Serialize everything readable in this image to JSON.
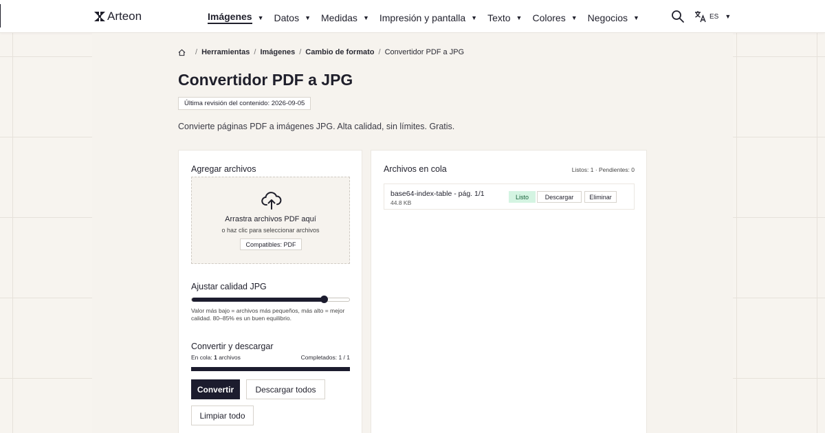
{
  "brand": {
    "name": "Arteon"
  },
  "nav": {
    "items": [
      {
        "label": "Imágenes",
        "active": true
      },
      {
        "label": "Datos"
      },
      {
        "label": "Medidas"
      },
      {
        "label": "Impresión y pantalla"
      },
      {
        "label": "Texto"
      },
      {
        "label": "Colores"
      },
      {
        "label": "Negocios"
      }
    ],
    "caret": "▼",
    "search_icon": "search-icon",
    "language": {
      "code": "ES",
      "icon": "translate-icon"
    }
  },
  "breadcrumb": {
    "home_icon": "home-icon",
    "items": [
      "Herramientas",
      "Imágenes",
      "Cambio de formato"
    ],
    "current": "Convertidor PDF a JPG",
    "separator": "/"
  },
  "page": {
    "title": "Convertidor PDF a JPG",
    "revised": "Última revisión del contenido: 2026-09-05",
    "subtitle": "Convierte páginas PDF a imágenes JPG. Alta calidad, sin límites. Gratis."
  },
  "left": {
    "add_title": "Agregar archivos",
    "dropzone": {
      "icon": "cloud-upload-icon",
      "main": "Arrastra archivos PDF aquí",
      "sub": "o haz clic para seleccionar archivos",
      "badge": "Compatibles: PDF"
    },
    "quality_title": "Ajustar calidad JPG",
    "quality_value": 0.84,
    "quality_help": "Valor más bajo = archivos más pequeños, más alto = mejor calidad. 80–85% es un buen equilibrio.",
    "convert_title": "Convertir y descargar",
    "queue_label": "En cola:",
    "queue_count": "1",
    "queue_suffix": "archivos",
    "completed": "Completados: 1 / 1",
    "progress": 1.0,
    "buttons": {
      "convert": "Convertir",
      "download_all": "Descargar todos",
      "clear_all": "Limpiar todo"
    }
  },
  "right": {
    "title": "Archivos en cola",
    "stats": "Listos: 1 · Pendientes: 0",
    "files": [
      {
        "name": "base64-index-table - pág. 1/1",
        "size": "44.8 KB",
        "status": "Listo",
        "download": "Descargar",
        "delete": "Eliminar"
      }
    ]
  },
  "colors": {
    "primary": "#1c1c2e",
    "success_bg": "#d4f4e2",
    "success_text": "#17603a",
    "page_bg": "#f7f4ef"
  }
}
